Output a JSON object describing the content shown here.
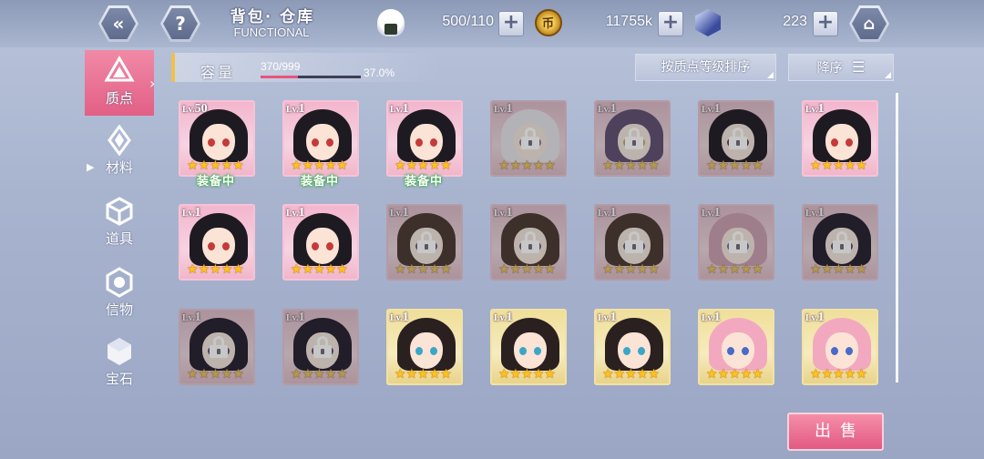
{
  "header": {
    "title": "背包· 仓库",
    "subtitle": "FUNCTIONAL",
    "back_icon": "double-chevron-left-icon",
    "help_label": "?",
    "home_icon": "home-icon",
    "resources": [
      {
        "icon": "rice-ball-icon",
        "value": "500/110"
      },
      {
        "icon": "coin-icon",
        "value": "11755k"
      },
      {
        "icon": "crystal-icon",
        "value": "223"
      }
    ],
    "plus_label": "+"
  },
  "sidebar": {
    "items": [
      {
        "label": "质点",
        "icon": "triangle-gem-icon",
        "active": true
      },
      {
        "label": "材料",
        "icon": "crystal-shard-icon",
        "active": false
      },
      {
        "label": "道具",
        "icon": "cube-icon",
        "active": false
      },
      {
        "label": "信物",
        "icon": "hex-token-icon",
        "active": false
      },
      {
        "label": "宝石",
        "icon": "gem-icon",
        "active": false
      }
    ],
    "expand_marker": "▶"
  },
  "capacity": {
    "label": "容量",
    "count": "370/999",
    "percent": "37.0%",
    "fill_fraction": 0.37
  },
  "sort": {
    "order_by": "按质点等级排序",
    "direction": "降序"
  },
  "cards": [
    {
      "lv": "50",
      "frame": "pink",
      "hair": "#1e1a22",
      "eye": "#c53a3a",
      "locked": false,
      "equipped": true
    },
    {
      "lv": "1",
      "frame": "pink",
      "hair": "#1e1a22",
      "eye": "#c53a3a",
      "locked": false,
      "equipped": true
    },
    {
      "lv": "1",
      "frame": "pink",
      "hair": "#1e1a22",
      "eye": "#c53a3a",
      "locked": false,
      "equipped": true
    },
    {
      "lv": "1",
      "frame": "pink",
      "hair": "#e6e3ef",
      "eye": "#8a7fb0",
      "locked": true,
      "equipped": false
    },
    {
      "lv": "1",
      "frame": "pink",
      "hair": "#6a4f8e",
      "eye": "#d9a43a",
      "locked": true,
      "equipped": false
    },
    {
      "lv": "1",
      "frame": "pink",
      "hair": "#2a2030",
      "eye": "#8a3a66",
      "locked": true,
      "equipped": false
    },
    {
      "lv": "1",
      "frame": "pink",
      "hair": "#1e1a22",
      "eye": "#c53a3a",
      "locked": false,
      "equipped": false
    },
    {
      "lv": "1",
      "frame": "pink",
      "hair": "#1e1a22",
      "eye": "#c53a3a",
      "locked": false,
      "equipped": false
    },
    {
      "lv": "1",
      "frame": "pink",
      "hair": "#1e1a22",
      "eye": "#c53a3a",
      "locked": false,
      "equipped": false
    },
    {
      "lv": "1",
      "frame": "pink",
      "hair": "#5a3a2e",
      "eye": "#7a5a9a",
      "locked": true,
      "equipped": false
    },
    {
      "lv": "1",
      "frame": "pink",
      "hair": "#5a3a2e",
      "eye": "#7a5a9a",
      "locked": true,
      "equipped": false
    },
    {
      "lv": "1",
      "frame": "pink",
      "hair": "#5a3a2e",
      "eye": "#7a5a9a",
      "locked": true,
      "equipped": false
    },
    {
      "lv": "1",
      "frame": "pink",
      "hair": "#e59ab8",
      "eye": "#5a7acb",
      "locked": true,
      "equipped": false
    },
    {
      "lv": "1",
      "frame": "pink",
      "hair": "#2c2440",
      "eye": "#6a4aa0",
      "locked": true,
      "equipped": false
    },
    {
      "lv": "1",
      "frame": "pink",
      "hair": "#2c2440",
      "eye": "#6a4aa0",
      "locked": true,
      "equipped": false
    },
    {
      "lv": "1",
      "frame": "pink",
      "hair": "#2c2440",
      "eye": "#6a4aa0",
      "locked": true,
      "equipped": false
    },
    {
      "lv": "1",
      "frame": "gold",
      "hair": "#2a2020",
      "eye": "#3aa6c8",
      "locked": false,
      "equipped": false
    },
    {
      "lv": "1",
      "frame": "gold",
      "hair": "#2a2020",
      "eye": "#3aa6c8",
      "locked": false,
      "equipped": false
    },
    {
      "lv": "1",
      "frame": "gold",
      "hair": "#2a2020",
      "eye": "#3aa6c8",
      "locked": false,
      "equipped": false
    },
    {
      "lv": "1",
      "frame": "gold",
      "hair": "#f2a9bf",
      "eye": "#4a6ac8",
      "locked": false,
      "equipped": false
    },
    {
      "lv": "1",
      "frame": "gold",
      "hair": "#f2a9bf",
      "eye": "#4a6ac8",
      "locked": false,
      "equipped": false
    }
  ],
  "lv_prefix": "Lv.",
  "equipped_label": "装备中",
  "star_glyph": "★",
  "star_count": 5,
  "sell_label": "出售",
  "colors": {
    "accent_pink": "#e35f86",
    "gold_frame": "#f0df9a",
    "pink_frame": "#f3b6cd"
  }
}
